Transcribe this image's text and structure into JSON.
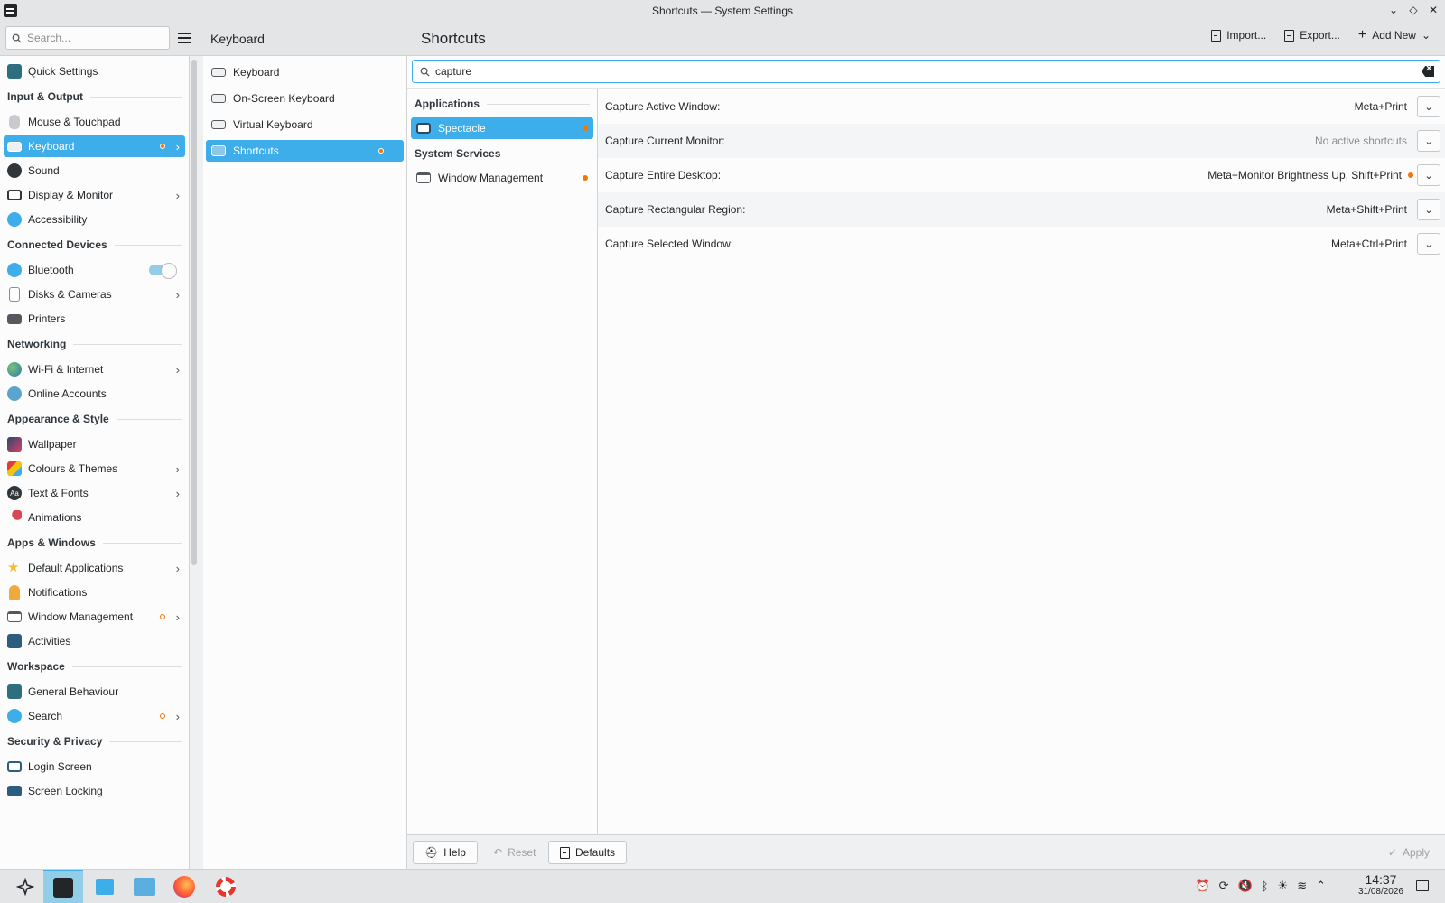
{
  "window": {
    "title": "Shortcuts — System Settings"
  },
  "header": {
    "search_placeholder": "Search...",
    "col2_title": "Keyboard",
    "col3_title": "Shortcuts",
    "import_label": "Import...",
    "export_label": "Export...",
    "add_new_label": "Add New"
  },
  "sidebar": {
    "quick_settings": "Quick Settings",
    "sections": {
      "input_output": "Input & Output",
      "connected_devices": "Connected Devices",
      "networking": "Networking",
      "appearance_style": "Appearance & Style",
      "apps_windows": "Apps & Windows",
      "workspace": "Workspace",
      "security_privacy": "Security & Privacy"
    },
    "items": {
      "mouse": "Mouse & Touchpad",
      "keyboard": "Keyboard",
      "sound": "Sound",
      "display": "Display & Monitor",
      "accessibility": "Accessibility",
      "bluetooth": "Bluetooth",
      "disks": "Disks & Cameras",
      "printers": "Printers",
      "wifi": "Wi-Fi & Internet",
      "online_accounts": "Online Accounts",
      "wallpaper": "Wallpaper",
      "colours": "Colours & Themes",
      "text_fonts": "Text & Fonts",
      "animations": "Animations",
      "default_apps": "Default Applications",
      "notifications": "Notifications",
      "window_mgmt": "Window Management",
      "activities": "Activities",
      "general_behaviour": "General Behaviour",
      "search": "Search",
      "login_screen": "Login Screen",
      "screen_locking": "Screen Locking"
    }
  },
  "col2": {
    "items": {
      "keyboard": "Keyboard",
      "onscreen": "On-Screen Keyboard",
      "virtual": "Virtual Keyboard",
      "shortcuts": "Shortcuts"
    }
  },
  "shortcuts_page": {
    "filter_value": "capture",
    "tree": {
      "applications": "Applications",
      "spectacle": "Spectacle",
      "system_services": "System Services",
      "window_management": "Window Management"
    },
    "rows": [
      {
        "name": "Capture Active Window:",
        "keys": "Meta+Print"
      },
      {
        "name": "Capture Current Monitor:",
        "keys": "No active shortcuts"
      },
      {
        "name": "Capture Entire Desktop:",
        "keys": "Meta+Monitor Brightness Up, Shift+Print"
      },
      {
        "name": "Capture Rectangular Region:",
        "keys": "Meta+Shift+Print"
      },
      {
        "name": "Capture Selected Window:",
        "keys": "Meta+Ctrl+Print"
      }
    ],
    "footer": {
      "help": "Help",
      "reset": "Reset",
      "defaults": "Defaults",
      "apply": "Apply"
    }
  },
  "taskbar": {
    "time": "14:37",
    "date": "31/08/2026"
  },
  "colors": {
    "accent": "#3daee9",
    "changed_indicator": "#f67400"
  }
}
